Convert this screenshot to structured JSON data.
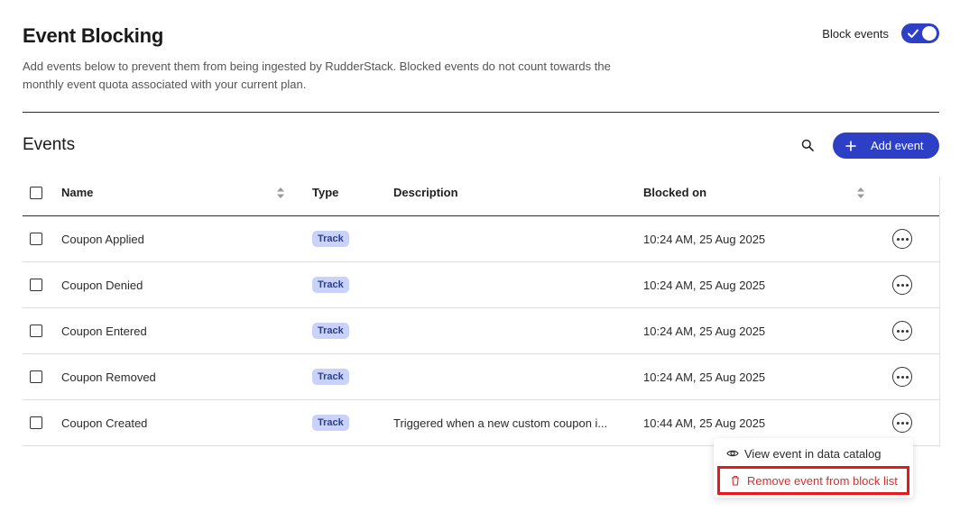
{
  "header": {
    "title": "Event Blocking",
    "description": "Add events below to prevent them from being ingested by RudderStack. Blocked events do not count towards the monthly event quota associated with your current plan.",
    "block_events_label": "Block events",
    "block_events_enabled": true
  },
  "events_section": {
    "title": "Events",
    "add_button_label": "Add event",
    "columns": {
      "name": "Name",
      "type": "Type",
      "description": "Description",
      "blocked_on": "Blocked on"
    },
    "rows": [
      {
        "name": "Coupon Applied",
        "type": "Track",
        "description": "",
        "blocked_on": "10:24 AM, 25 Aug 2025"
      },
      {
        "name": "Coupon Denied",
        "type": "Track",
        "description": "",
        "blocked_on": "10:24 AM, 25 Aug 2025"
      },
      {
        "name": "Coupon Entered",
        "type": "Track",
        "description": "",
        "blocked_on": "10:24 AM, 25 Aug 2025"
      },
      {
        "name": "Coupon Removed",
        "type": "Track",
        "description": "",
        "blocked_on": "10:24 AM, 25 Aug 2025"
      },
      {
        "name": "Coupon Created",
        "type": "Track",
        "description": "Triggered when a new custom coupon i...",
        "blocked_on": "10:44 AM, 25 Aug 2025"
      }
    ]
  },
  "context_menu": {
    "view_label": "View event in data catalog",
    "remove_label": "Remove event from block list"
  },
  "colors": {
    "accent": "#2d3ec7",
    "badge_bg": "#c9d2f8",
    "danger": "#d32f2f",
    "highlight_border": "#e81818"
  },
  "icons": [
    "check-icon",
    "search-icon",
    "plus-icon",
    "sort-icon",
    "more-icon",
    "eye-icon",
    "trash-icon"
  ]
}
